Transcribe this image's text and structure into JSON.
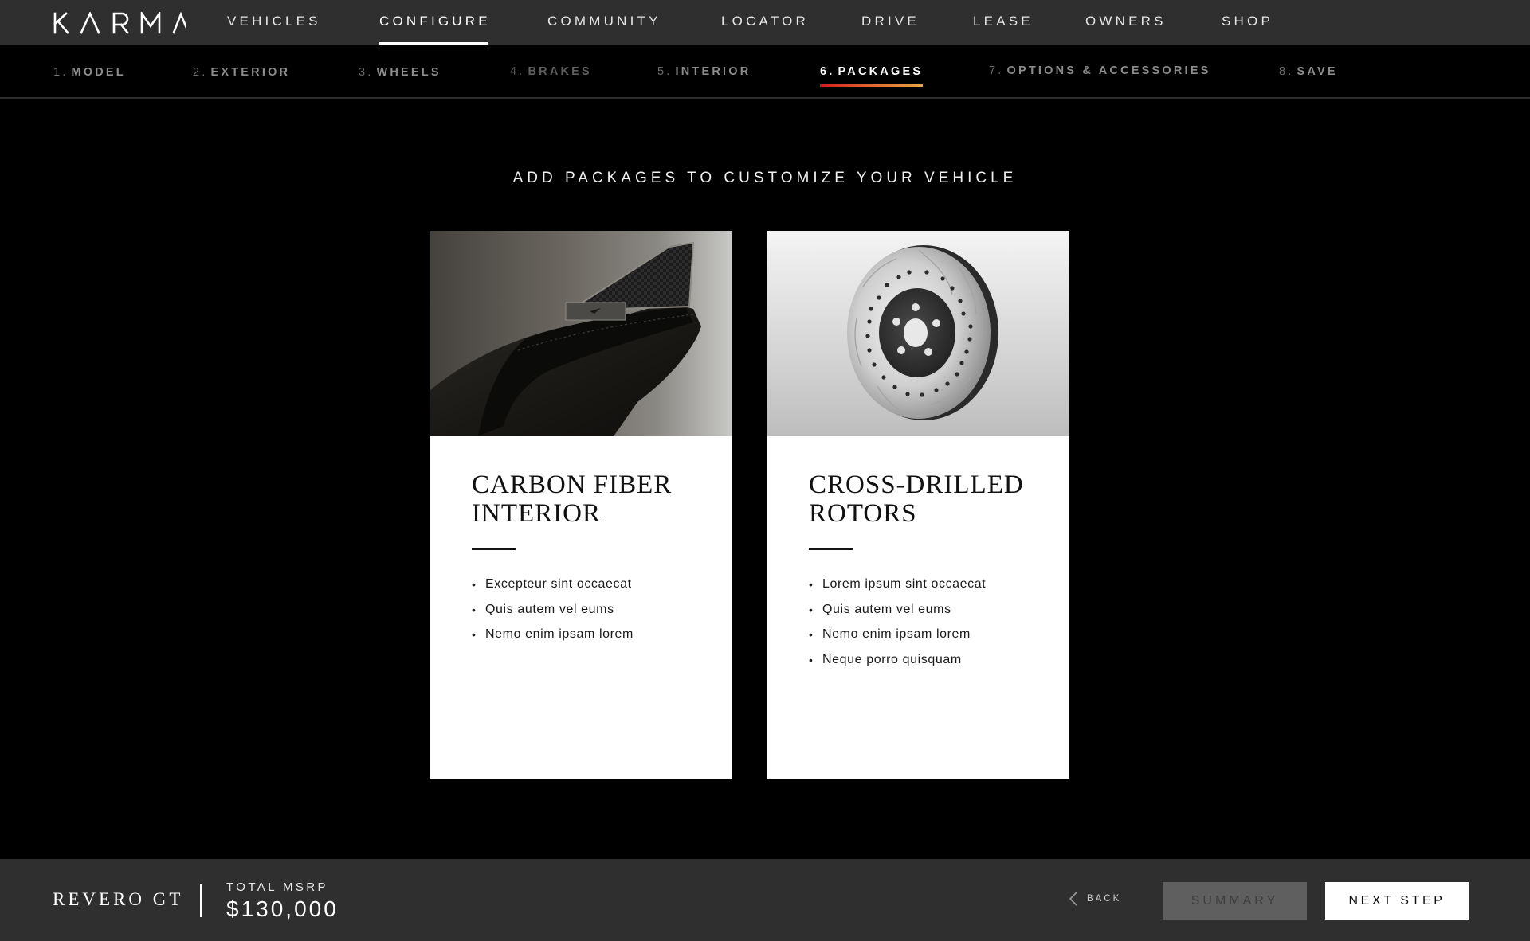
{
  "brand": {
    "logo_text": "KARMA"
  },
  "nav": {
    "items": [
      {
        "label": "VEHICLES"
      },
      {
        "label": "CONFIGURE"
      },
      {
        "label": "COMMUNITY"
      },
      {
        "label": "LOCATOR"
      },
      {
        "label": "DRIVE"
      },
      {
        "label": "LEASE"
      },
      {
        "label": "OWNERS"
      },
      {
        "label": "SHOP"
      }
    ],
    "active": "CONFIGURE"
  },
  "steps": {
    "items": [
      {
        "num": "1.",
        "label": "MODEL"
      },
      {
        "num": "2.",
        "label": "EXTERIOR"
      },
      {
        "num": "3.",
        "label": "WHEELS"
      },
      {
        "num": "4.",
        "label": "BRAKES"
      },
      {
        "num": "5.",
        "label": "INTERIOR"
      },
      {
        "num": "6.",
        "label": "PACKAGES"
      },
      {
        "num": "7.",
        "label": "OPTIONS & ACCESSORIES"
      },
      {
        "num": "8.",
        "label": "SAVE"
      }
    ],
    "active": "PACKAGES",
    "active_underline_colors": [
      "#d21b1b",
      "#e0622a",
      "#e9a440"
    ]
  },
  "main": {
    "heading": "ADD PACKAGES TO CUSTOMIZE YOUR VEHICLE",
    "packages": [
      {
        "title": "CARBON FIBER INTERIOR",
        "image_icon": "carbon-fiber-door-panel-image",
        "features": [
          "Excepteur sint occaecat",
          "Quis autem vel eums",
          "Nemo enim ipsam lorem"
        ]
      },
      {
        "title": "CROSS-DRILLED ROTORS",
        "image_icon": "brake-rotor-image",
        "features": [
          "Lorem ipsum sint occaecat",
          "Quis autem vel eums",
          "Nemo enim ipsam lorem",
          "Neque porro quisquam"
        ]
      }
    ]
  },
  "footer": {
    "model": "REVERO GT",
    "msrp_label": "TOTAL MSRP",
    "msrp_value": "$130,000",
    "back_label": "BACK",
    "summary_label": "SUMMARY",
    "next_label": "NEXT STEP"
  }
}
